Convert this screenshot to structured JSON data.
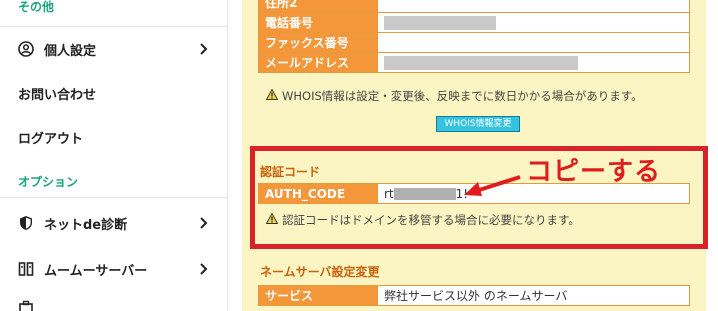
{
  "sidebar": {
    "section_other": "その他",
    "section_option": "オプション",
    "items": [
      {
        "label": "個人設定"
      },
      {
        "label": "お問い合わせ"
      },
      {
        "label": "ログアウト"
      },
      {
        "label": "ネットde診断"
      },
      {
        "label": "ムームーサーバー"
      }
    ]
  },
  "contact_table": {
    "rows": [
      {
        "label": "住所2",
        "value": ""
      },
      {
        "label": "電話番号",
        "value": ""
      },
      {
        "label": "ファックス番号",
        "value": ""
      },
      {
        "label": "メールアドレス",
        "value": ""
      }
    ]
  },
  "whois_note": "WHOIS情報は設定・変更後、反映までに数日かかる場合があります。",
  "whois_button": "WHOIS情報変更",
  "auth_section": {
    "title": "認証コード",
    "label": "AUTH_CODE",
    "value_prefix": "rt",
    "value_suffix": "1!",
    "note": "認証コードはドメインを移管する場合に必要になります。"
  },
  "annotation": {
    "text": "コピーする",
    "color": "#e01d1d"
  },
  "nameserver_section": {
    "title": "ネームサーバ設定変更",
    "label": "サービス",
    "value": "弊社サービス以外 のネームサーバ"
  },
  "colors": {
    "accent_green": "#1aa37e",
    "label_orange": "#f3973a",
    "panel_bg": "#fbf4c3",
    "highlight_red": "#d9232a"
  }
}
